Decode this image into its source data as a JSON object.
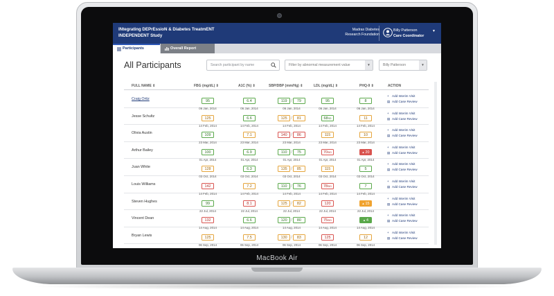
{
  "device": {
    "brand_label": "MacBook Air"
  },
  "app": {
    "title_line1": "INtegrating DEPrEssioN & Diabetes TreatmENT",
    "title_line2": "INDEPENDENT Study",
    "org_name_line1": "Madras Diabetes",
    "org_name_line2": "Research Foundation",
    "user_name": "Billy Patterson",
    "user_role": "Care Coordinator"
  },
  "tabs": [
    {
      "label": "Participants",
      "active": true
    },
    {
      "label": "Overall Report",
      "active": false
    }
  ],
  "page": {
    "title": "All Participants",
    "search_placeholder": "Search participant by name",
    "filter_placeholder": "Filter by abnormal measurement value",
    "person_select": "Billy Patterson"
  },
  "table": {
    "headers": [
      "FULL NAME",
      "FBG (mg/dL)",
      "A1C (%)",
      "SBP/DBP (mm/Hg)",
      "LDL (mg/dL)",
      "PHQ-9",
      "ACTION"
    ],
    "actions": {
      "visit": "Add Interim Visit",
      "review": "Add Case Review"
    },
    "rows": [
      {
        "name": "Craig Ortiz",
        "link": true,
        "fbg": {
          "v": "95",
          "s": "green",
          "d": "06 Jan, 2014"
        },
        "a1c": {
          "v": "6.4",
          "s": "green",
          "d": "06 Jan, 2014"
        },
        "sbp": {
          "v": "119",
          "s": "green"
        },
        "dbp": {
          "v": "79",
          "s": "green"
        },
        "bp_d": "06 Jan, 2014",
        "ldl": {
          "v": "95",
          "s": "green",
          "d": "06 Jan, 2014"
        },
        "phq": {
          "v": "8",
          "s": "green",
          "d": "06 Jan, 2014"
        }
      },
      {
        "name": "Jesse Schultz",
        "link": false,
        "fbg": {
          "v": "125",
          "s": "amber",
          "d": "14 Feb, 2014"
        },
        "a1c": {
          "v": "6.6",
          "s": "green",
          "d": "14 Feb, 2014"
        },
        "sbp": {
          "v": "125",
          "s": "amber"
        },
        "dbp": {
          "v": "81",
          "s": "amber"
        },
        "bp_d": "14 Feb, 2014",
        "ldl": {
          "v": "68",
          "s": "green",
          "sup": "SD",
          "d": "14 Feb, 2014"
        },
        "phq": {
          "v": "11",
          "s": "amber",
          "d": "14 Feb, 2014"
        }
      },
      {
        "name": "Olivia Austin",
        "link": false,
        "fbg": {
          "v": "109",
          "s": "green",
          "d": "23 Mar, 2014"
        },
        "a1c": {
          "v": "7.1",
          "s": "amber",
          "d": "23 Mar, 2014"
        },
        "sbp": {
          "v": "140",
          "s": "red"
        },
        "dbp": {
          "v": "86",
          "s": "red"
        },
        "bp_d": "23 Mar, 2014",
        "ldl": {
          "v": "115",
          "s": "amber",
          "d": "23 Mar, 2014"
        },
        "phq": {
          "v": "10",
          "s": "amber",
          "d": "23 Mar, 2014"
        }
      },
      {
        "name": "Arthur Bailey",
        "link": false,
        "fbg": {
          "v": "100",
          "s": "green",
          "d": "01 Apr, 2014"
        },
        "a1c": {
          "v": "6.9",
          "s": "green",
          "d": "01 Apr, 2014"
        },
        "sbp": {
          "v": "110",
          "s": "green"
        },
        "dbp": {
          "v": "75",
          "s": "green"
        },
        "bp_d": "01 Apr, 2014",
        "ldl": {
          "v": "70",
          "s": "red",
          "sup": "SID",
          "d": "01 Apr, 2014"
        },
        "phq": {
          "v": "20",
          "s": "solid-red",
          "icon": "▲",
          "d": "01 Apr, 2014"
        }
      },
      {
        "name": "Juan White",
        "link": false,
        "fbg": {
          "v": "128",
          "s": "amber",
          "d": "03 Oct, 2014"
        },
        "a1c": {
          "v": "6.3",
          "s": "green",
          "d": "03 Oct, 2014"
        },
        "sbp": {
          "v": "135",
          "s": "amber"
        },
        "dbp": {
          "v": "85",
          "s": "amber"
        },
        "bp_d": "03 Oct, 2014",
        "ldl": {
          "v": "115",
          "s": "amber",
          "d": "03 Oct, 2014"
        },
        "phq": {
          "v": "5",
          "s": "green",
          "d": "03 Oct, 2014"
        }
      },
      {
        "name": "Louis Williams",
        "link": false,
        "fbg": {
          "v": "142",
          "s": "red",
          "d": "14 Feb, 2014"
        },
        "a1c": {
          "v": "7.2",
          "s": "amber",
          "d": "14 Feb, 2014"
        },
        "sbp": {
          "v": "110",
          "s": "green"
        },
        "dbp": {
          "v": "76",
          "s": "green"
        },
        "bp_d": "14 Feb, 2014",
        "ldl": {
          "v": "78",
          "s": "red",
          "sup": "SID",
          "d": "14 Feb, 2014"
        },
        "phq": {
          "v": "7",
          "s": "green",
          "d": "14 Feb, 2014"
        }
      },
      {
        "name": "Steven Hughes",
        "link": false,
        "fbg": {
          "v": "99",
          "s": "green",
          "d": "22 Jul, 2014"
        },
        "a1c": {
          "v": "8.1",
          "s": "red",
          "d": "22 Jul, 2014"
        },
        "sbp": {
          "v": "125",
          "s": "amber"
        },
        "dbp": {
          "v": "82",
          "s": "amber"
        },
        "bp_d": "22 Jul, 2014",
        "ldl": {
          "v": "120",
          "s": "red",
          "d": "22 Jul, 2014"
        },
        "phq": {
          "v": "15",
          "s": "solid-amber",
          "icon": "▲",
          "d": "22 Jul, 2014"
        }
      },
      {
        "name": "Vincent Dean",
        "link": false,
        "fbg": {
          "v": "132",
          "s": "red",
          "d": "14 Aug, 2014"
        },
        "a1c": {
          "v": "6.6",
          "s": "green",
          "d": "14 Aug, 2014"
        },
        "sbp": {
          "v": "120",
          "s": "green"
        },
        "dbp": {
          "v": "80",
          "s": "green"
        },
        "bp_d": "14 Aug, 2014",
        "ldl": {
          "v": "75",
          "s": "red",
          "sup": "SID",
          "d": "14 Aug, 2014"
        },
        "phq": {
          "v": "4",
          "s": "solid-green",
          "icon": "▲",
          "d": "14 Aug, 2014"
        }
      },
      {
        "name": "Bryan Lewis",
        "link": false,
        "fbg": {
          "v": "125",
          "s": "amber",
          "d": "06 Sep, 2014"
        },
        "a1c": {
          "v": "7.5",
          "s": "amber",
          "d": "06 Sep, 2014"
        },
        "sbp": {
          "v": "130",
          "s": "amber"
        },
        "dbp": {
          "v": "83",
          "s": "amber"
        },
        "bp_d": "06 Sep, 2014",
        "ldl": {
          "v": "125",
          "s": "red",
          "d": "06 Sep, 2014"
        },
        "phq": {
          "v": "12",
          "s": "amber",
          "d": "06 Sep, 2014"
        }
      }
    ]
  }
}
